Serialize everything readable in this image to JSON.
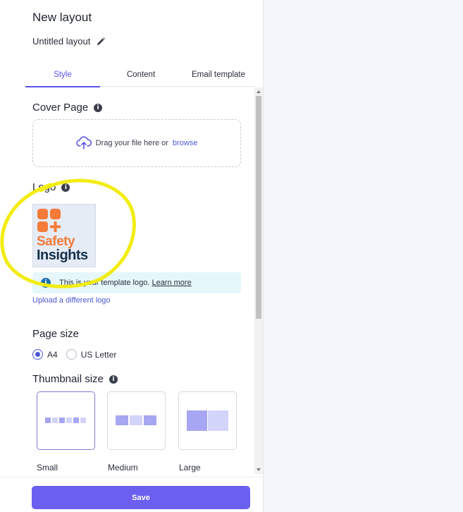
{
  "header": {
    "title": "New layout",
    "layout_name": "Untitled layout"
  },
  "tabs": [
    {
      "label": "Style",
      "active": true
    },
    {
      "label": "Content",
      "active": false
    },
    {
      "label": "Email template",
      "active": false
    }
  ],
  "cover_page": {
    "title": "Cover Page",
    "drop_text": "Drag your file here or",
    "browse_label": "browse"
  },
  "logo": {
    "title": "Logo",
    "image_line1": "Safety",
    "image_line2": "Insights",
    "banner_text": "This is your template logo.",
    "banner_link": "Learn more",
    "upload_link": "Upload a different logo"
  },
  "page_size": {
    "title": "Page size",
    "options": [
      {
        "label": "A4",
        "checked": true
      },
      {
        "label": "US Letter",
        "checked": false
      }
    ]
  },
  "thumbnail_size": {
    "title": "Thumbnail size",
    "options": [
      {
        "label": "Small",
        "selected": true
      },
      {
        "label": "Medium",
        "selected": false
      },
      {
        "label": "Large",
        "selected": false
      }
    ]
  },
  "footer": {
    "save_label": "Save"
  },
  "colors": {
    "accent": "#5b54e8",
    "save_button": "#6b5ff0",
    "highlight": "#f2ec14",
    "logo_orange": "#f47b3a",
    "logo_navy": "#14304a"
  }
}
